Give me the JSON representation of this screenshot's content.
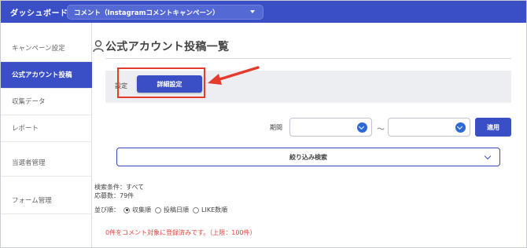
{
  "header": {
    "brand": "ダッシュボード",
    "campaign_select": "コメント（Instagramコメントキャンペーン）"
  },
  "sidebar": {
    "items": [
      {
        "label": "キャンペーン設定",
        "active": false
      },
      {
        "label": "公式アカウント投稿",
        "active": true
      },
      {
        "label": "収集データ",
        "active": false
      },
      {
        "label": "レポート",
        "active": false
      },
      {
        "label": "当選者管理",
        "active": false
      },
      {
        "label": "フォーム管理",
        "active": false
      }
    ]
  },
  "main": {
    "title": "公式アカウント投稿一覧",
    "settings_label": "設定",
    "detail_button": "詳細設定",
    "period_label": "期間",
    "period_start": "",
    "period_end": "",
    "tilde": "〜",
    "apply_button": "適用",
    "filter_label": "絞り込み検索",
    "search_condition": "検索条件：すべて",
    "entry_count": "応募数：79件",
    "sort_label": "並び順：",
    "sort_options": [
      {
        "label": "収集順",
        "selected": true
      },
      {
        "label": "投稿日順",
        "selected": false
      },
      {
        "label": "LIKE数順",
        "selected": false
      }
    ],
    "notice": "0件をコメント対象に登録済みです。（上限：100件）"
  },
  "colors": {
    "primary": "#3a4fc5",
    "highlight": "#e53b2c",
    "notice": "#e0443a"
  }
}
